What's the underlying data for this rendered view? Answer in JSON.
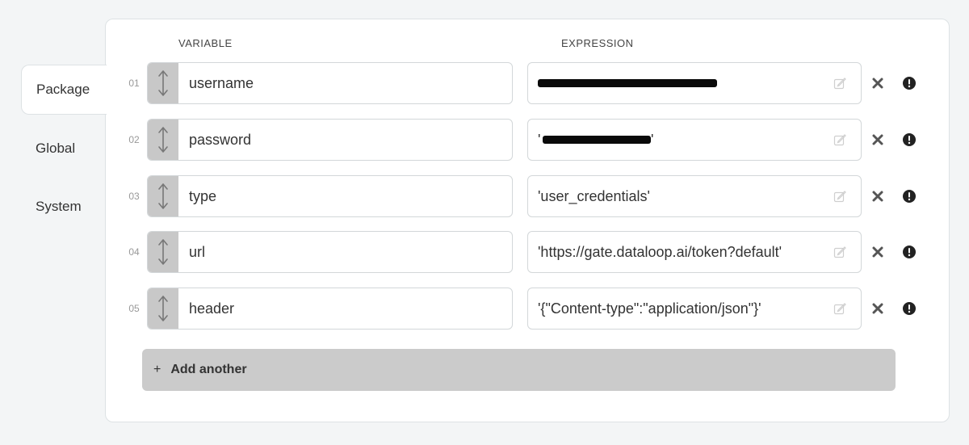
{
  "tabs": [
    {
      "label": "Package",
      "active": true
    },
    {
      "label": "Global",
      "active": false
    },
    {
      "label": "System",
      "active": false
    }
  ],
  "columns": {
    "variable": "VARIABLE",
    "expression": "EXPRESSION"
  },
  "rows": [
    {
      "num": "01",
      "variable": "username",
      "expression": "",
      "redacted": true
    },
    {
      "num": "02",
      "variable": "password",
      "expression": "'",
      "expression_suffix": "'",
      "redacted": true
    },
    {
      "num": "03",
      "variable": "type",
      "expression": "'user_credentials'",
      "redacted": false
    },
    {
      "num": "04",
      "variable": "url",
      "expression": "'https://gate.dataloop.ai/token?default'",
      "redacted": false
    },
    {
      "num": "05",
      "variable": "header",
      "expression": "'{\"Content-type\":\"application/json\"}'",
      "redacted": false
    }
  ],
  "add_button": {
    "plus": "+",
    "label": "Add another"
  },
  "icons": {
    "drag": "drag-vertical-arrows-icon",
    "edit": "edit-pencil-icon",
    "delete": "close-x-icon",
    "info": "exclamation-circle-icon"
  },
  "colors": {
    "background": "#f3f5f6",
    "panel": "#ffffff",
    "handle": "#c8c8c8",
    "add_button": "#cbcbcb",
    "redaction": "#0a0a0a"
  }
}
